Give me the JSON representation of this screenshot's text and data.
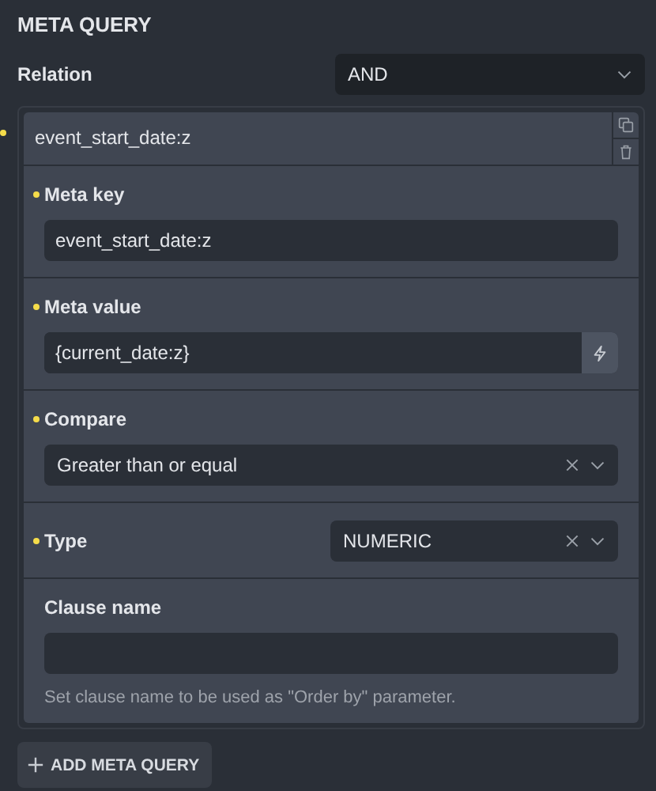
{
  "section_title": "META QUERY",
  "relation": {
    "label": "Relation",
    "value": "AND",
    "clearable": false
  },
  "clauses": [
    {
      "title": "event_start_date:z",
      "modified": true,
      "fields": [
        {
          "kind": "text",
          "label": "Meta key",
          "modified": true,
          "value": "event_start_date:z"
        },
        {
          "kind": "dynamic",
          "label": "Meta value",
          "modified": true,
          "value": "{current_date:z}"
        },
        {
          "kind": "select",
          "label": "Compare",
          "modified": true,
          "value": "Greater than or equal",
          "clearable": true
        },
        {
          "kind": "inline-select",
          "label": "Type",
          "modified": true,
          "value": "NUMERIC",
          "clearable": true
        },
        {
          "kind": "text",
          "label": "Clause name",
          "modified": false,
          "hint": "Set clause name to be used as \"Order by\" parameter."
        }
      ]
    }
  ],
  "add_button": {
    "label": "ADD META QUERY"
  }
}
